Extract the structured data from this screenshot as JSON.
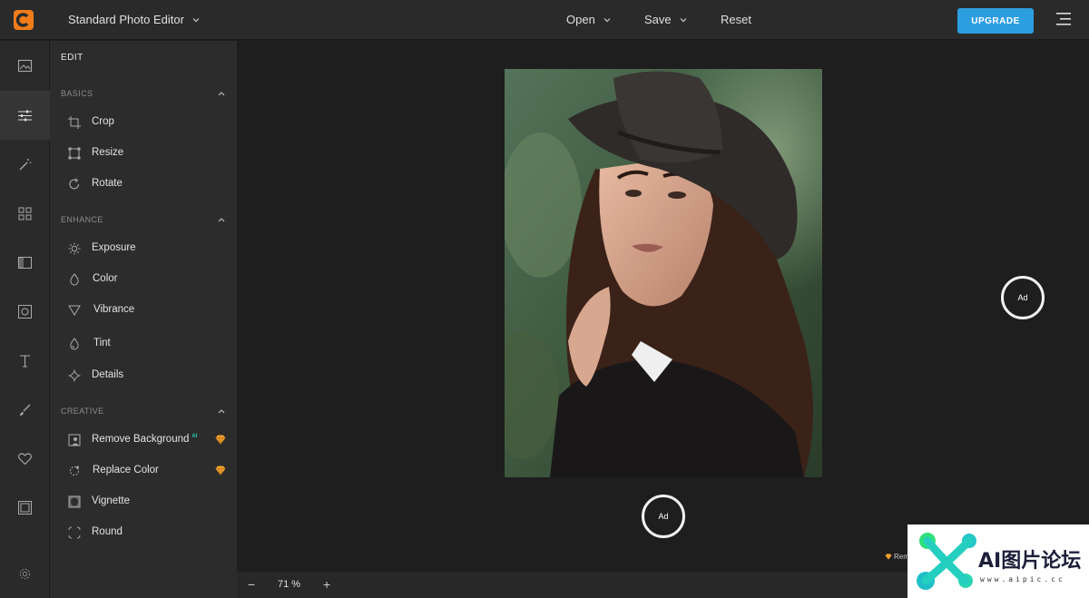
{
  "header": {
    "app_title": "Standard Photo Editor",
    "menu": {
      "open": "Open",
      "save": "Save",
      "reset": "Reset"
    },
    "upgrade_label": "UPGRADE",
    "accent_color": "#2b9ee0",
    "logo_color": "#f07d1a"
  },
  "rail": {
    "items": [
      "image-icon",
      "sliders-icon",
      "magic-wand-icon",
      "grid-icon",
      "frame-panel-icon",
      "photo-frame-icon",
      "text-icon",
      "brush-icon",
      "heart-icon",
      "border-icon",
      "settings-icon"
    ],
    "active": "sliders-icon"
  },
  "panel": {
    "title": "EDIT",
    "sections": {
      "basics": {
        "label": "BASICS",
        "tools": [
          "Crop",
          "Resize",
          "Rotate"
        ]
      },
      "enhance": {
        "label": "ENHANCE",
        "tools": [
          "Exposure",
          "Color",
          "Vibrance",
          "Tint",
          "Details"
        ]
      },
      "creative": {
        "label": "CREATIVE",
        "tools": [
          "Remove Background",
          "Replace Color",
          "Vignette",
          "Round"
        ],
        "ai_badge": "AI"
      }
    }
  },
  "canvas": {
    "ad_label": "Ad",
    "remove_tag": "Rem"
  },
  "zoom": {
    "minus": "−",
    "value": "71 %",
    "plus": "+"
  },
  "watermark": {
    "text": "AI图片论坛",
    "url": "www.aipic.cc"
  }
}
